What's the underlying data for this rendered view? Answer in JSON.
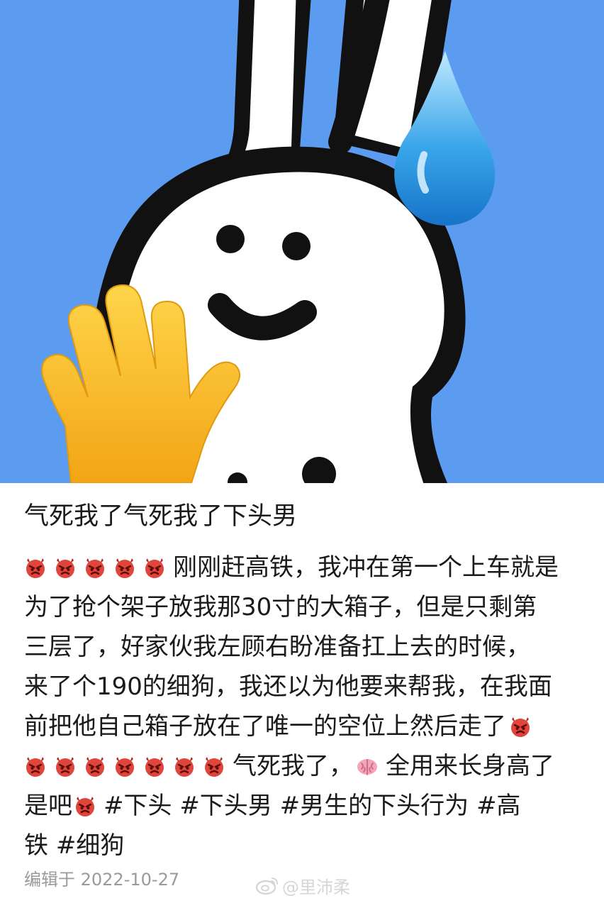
{
  "post": {
    "title": "气死我了气死我了下头男",
    "lines": [
      "刚刚赶高铁，我冲在第一个上车就是",
      "为了抢个架子放我那30寸的大箱子，但是只剩第",
      "三层了，好家伙我左顾右盼准备扛上去的时候，",
      "来了个190的细狗，我还以为他要来帮我，在我面",
      "前把他自己箱子放在了唯一的空位上然后走了",
      "气死我了，",
      "全用来长身高了",
      "是吧"
    ],
    "tags": [
      "#下头",
      "#下头男",
      "#男生的下头行为",
      "#高",
      "铁",
      "#细狗"
    ],
    "edited": "编辑于 2022-10-27",
    "watermark": "@里沛柔"
  },
  "icons": {
    "angry": "angry-devil-face-icon",
    "brain": "brain-icon",
    "weibo": "weibo-logo-icon",
    "hand": "waving-hand-icon",
    "drop": "sweat-drop-icon"
  },
  "colors": {
    "background": "#5b9cf0",
    "text": "#1b1b1b",
    "meta": "#9a9a9a",
    "angry_red": "#e0443a"
  }
}
